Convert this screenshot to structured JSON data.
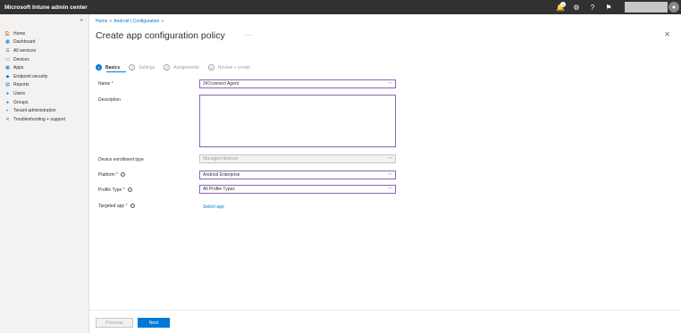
{
  "app": {
    "title": "Microsoft Intune admin center"
  },
  "topbar": {
    "notification_count": "1"
  },
  "sidebar": {
    "collapse": "«",
    "items": [
      {
        "label": "Home",
        "icon": "home-icon",
        "glyph": "🏠",
        "color": "#0078d4"
      },
      {
        "label": "Dashboard",
        "icon": "dashboard-icon",
        "glyph": "▦",
        "color": "#0078d4"
      },
      {
        "label": "All services",
        "icon": "all-services-icon",
        "glyph": "☰",
        "color": "#605e5c"
      },
      {
        "label": "Devices",
        "icon": "devices-icon",
        "glyph": "▭",
        "color": "#0078d4"
      },
      {
        "label": "Apps",
        "icon": "apps-icon",
        "glyph": "▦",
        "color": "#0078d4"
      },
      {
        "label": "Endpoint security",
        "icon": "shield-icon",
        "glyph": "◆",
        "color": "#0078d4"
      },
      {
        "label": "Reports",
        "icon": "reports-icon",
        "glyph": "▤",
        "color": "#0078d4"
      },
      {
        "label": "Users",
        "icon": "users-icon",
        "glyph": "●",
        "color": "#0078d4"
      },
      {
        "label": "Groups",
        "icon": "groups-icon",
        "glyph": "●",
        "color": "#0078d4"
      },
      {
        "label": "Tenant administration",
        "icon": "tenant-admin-icon",
        "glyph": "◐",
        "color": "#0078d4"
      },
      {
        "label": "Troubleshooting + support",
        "icon": "wrench-icon",
        "glyph": "✕",
        "color": "#0078d4"
      }
    ]
  },
  "breadcrumb": {
    "home": "Home",
    "sep": ">",
    "section": "Android | Configuration",
    "trail_sep": ">"
  },
  "page": {
    "title": "Create app configuration policy",
    "more": "···",
    "close": "✕"
  },
  "steps": [
    {
      "num": "1",
      "label": "Basics"
    },
    {
      "num": "2",
      "label": "Settings"
    },
    {
      "num": "3",
      "label": "Assignments"
    },
    {
      "num": "4",
      "label": "Review + create"
    }
  ],
  "form": {
    "name_label": "Name",
    "name_value": "247connect Agent",
    "description_label": "Description",
    "enrollment_label": "Device enrollment type",
    "enrollment_value": "Managed devices",
    "platform_label": "Platform",
    "platform_value": "Android Enterprise",
    "profile_label": "Profile Type",
    "profile_value": "All Profile Types",
    "targeted_label": "Targeted app",
    "select_app": "Select app",
    "required_mark": "*",
    "info": "i",
    "chevron": "﹀"
  },
  "footer": {
    "previous": "Previous",
    "next": "Next"
  }
}
